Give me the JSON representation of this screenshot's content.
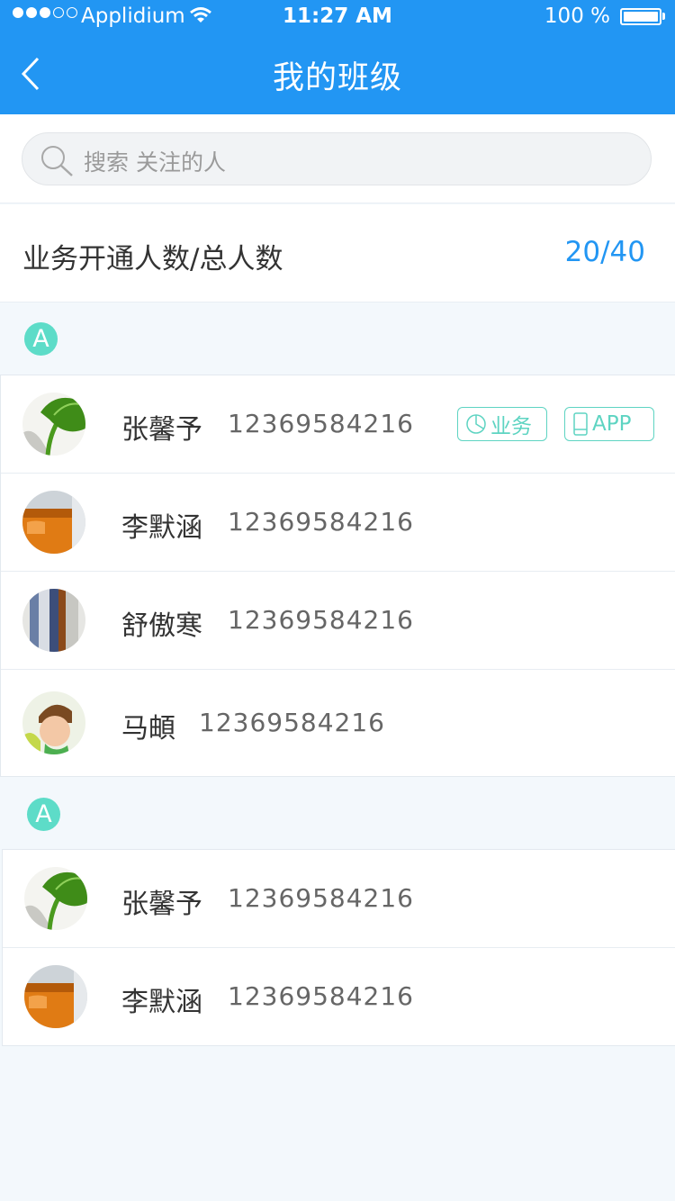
{
  "status_bar": {
    "carrier": "Applidium",
    "time": "11:27 AM",
    "battery": "100 %"
  },
  "nav": {
    "title": "我的班级"
  },
  "search": {
    "placeholder": "搜索 关注的人"
  },
  "summary": {
    "label": "业务开通人数/总人数",
    "value": "20/40"
  },
  "colors": {
    "accent": "#2296f3",
    "tag": "#5ed4c2",
    "section_letter": "#5ddcc8"
  },
  "sections": [
    {
      "letter": "A",
      "members": [
        {
          "name": "张馨予",
          "phone": "12369584216",
          "avatar": "plant-avatar",
          "tags": [
            "业务",
            "APP"
          ]
        },
        {
          "name": "李默涵",
          "phone": "12369584216",
          "avatar": "mug-avatar",
          "tags": []
        },
        {
          "name": "舒傲寒",
          "phone": "12369584216",
          "avatar": "books-avatar",
          "tags": []
        },
        {
          "name": "马頔",
          "phone": "12369584216",
          "avatar": "boy-avatar",
          "tags": []
        }
      ]
    },
    {
      "letter": "A",
      "members": [
        {
          "name": "张馨予",
          "phone": "12369584216",
          "avatar": "plant-avatar",
          "tags": []
        },
        {
          "name": "李默涵",
          "phone": "12369584216",
          "avatar": "mug-avatar",
          "tags": []
        }
      ]
    }
  ]
}
